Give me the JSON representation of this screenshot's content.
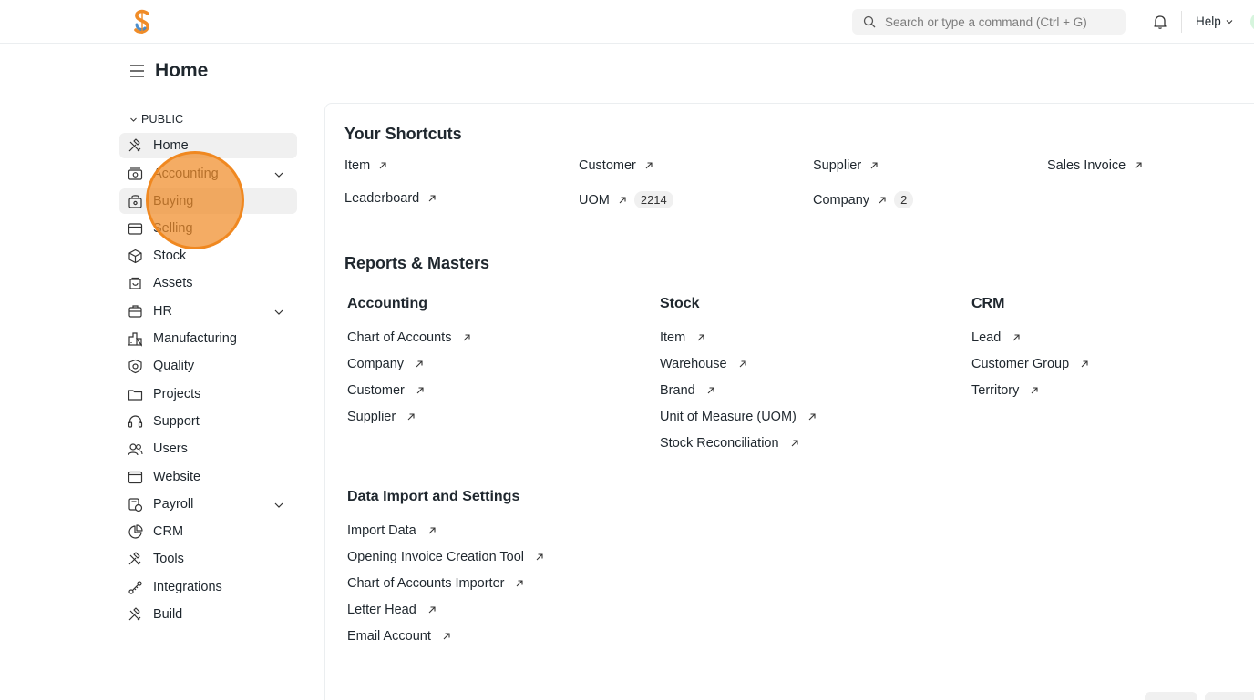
{
  "navbar": {
    "search_placeholder": "Search or type a command (Ctrl + G)",
    "help_label": "Help"
  },
  "page": {
    "title": "Home"
  },
  "sidebar": {
    "section_label": "PUBLIC",
    "items": [
      {
        "label": "Home",
        "icon": "tools-icon",
        "active": true
      },
      {
        "label": "Accounting",
        "icon": "accounting-icon",
        "expandable": true
      },
      {
        "label": "Buying",
        "icon": "buying-icon",
        "active": true
      },
      {
        "label": "Selling",
        "icon": "selling-icon"
      },
      {
        "label": "Stock",
        "icon": "stock-icon"
      },
      {
        "label": "Assets",
        "icon": "assets-icon"
      },
      {
        "label": "HR",
        "icon": "hr-icon",
        "expandable": true
      },
      {
        "label": "Manufacturing",
        "icon": "manufacturing-icon"
      },
      {
        "label": "Quality",
        "icon": "quality-icon"
      },
      {
        "label": "Projects",
        "icon": "projects-icon"
      },
      {
        "label": "Support",
        "icon": "support-icon"
      },
      {
        "label": "Users",
        "icon": "users-icon"
      },
      {
        "label": "Website",
        "icon": "website-icon"
      },
      {
        "label": "Payroll",
        "icon": "payroll-icon",
        "expandable": true
      },
      {
        "label": "CRM",
        "icon": "crm-icon"
      },
      {
        "label": "Tools",
        "icon": "tools-icon"
      },
      {
        "label": "Integrations",
        "icon": "integrations-icon"
      },
      {
        "label": "Build",
        "icon": "build-icon"
      }
    ]
  },
  "shortcuts": {
    "title": "Your Shortcuts",
    "items": [
      {
        "label": "Item"
      },
      {
        "label": "Customer"
      },
      {
        "label": "Supplier"
      },
      {
        "label": "Sales Invoice"
      },
      {
        "label": "Leaderboard"
      },
      {
        "label": "UOM",
        "count": "2214"
      },
      {
        "label": "Company",
        "count": "2"
      }
    ]
  },
  "reports": {
    "title": "Reports & Masters",
    "cards": [
      {
        "title": "Accounting",
        "links": [
          "Chart of Accounts",
          "Company",
          "Customer",
          "Supplier"
        ]
      },
      {
        "title": "Stock",
        "links": [
          "Item",
          "Warehouse",
          "Brand",
          "Unit of Measure (UOM)",
          "Stock Reconciliation"
        ]
      },
      {
        "title": "CRM",
        "links": [
          "Lead",
          "Customer Group",
          "Territory"
        ]
      },
      {
        "title": "Data Import and Settings",
        "links": [
          "Import Data",
          "Opening Invoice Creation Tool",
          "Chart of Accounts Importer",
          "Letter Head",
          "Email Account"
        ]
      }
    ]
  },
  "colors": {
    "brand_orange": "#f08c28",
    "brand_blue": "#3b82c4",
    "text": "#1f272e"
  }
}
